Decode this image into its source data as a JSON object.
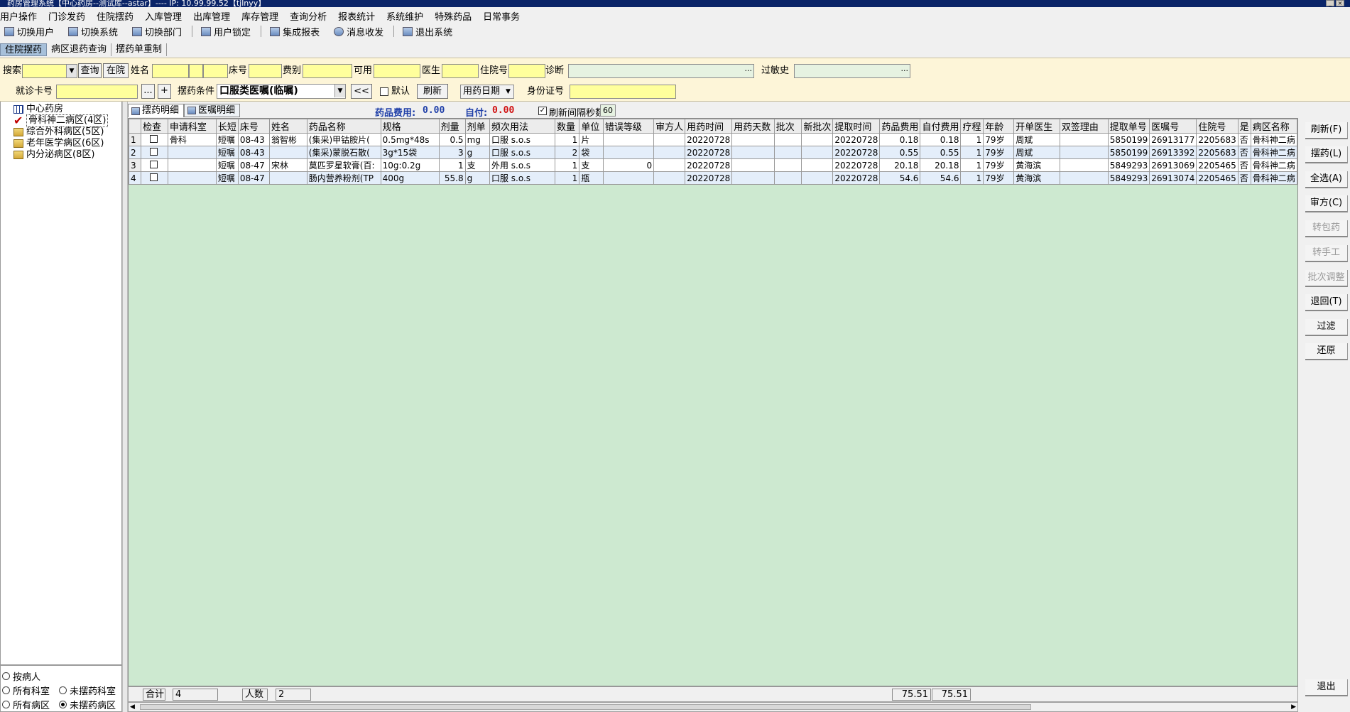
{
  "window": {
    "title": "药房管理系统【中心药房--测试库--astar】---- IP: 10.99.99.52【tjlnyy】",
    "controls": [
      "_",
      "×"
    ]
  },
  "menu": [
    "用户操作",
    "门诊发药",
    "住院摆药",
    "入库管理",
    "出库管理",
    "库存管理",
    "查询分析",
    "报表统计",
    "系统维护",
    "特殊药品",
    "日常事务"
  ],
  "toolbar": [
    {
      "label": "切换用户",
      "icon": "user-switch-icon"
    },
    {
      "label": "切换系统",
      "icon": "system-switch-icon"
    },
    {
      "label": "切换部门",
      "icon": "department-switch-icon"
    },
    {
      "label": "用户锁定",
      "icon": "lock-user-icon"
    },
    {
      "label": "集成报表",
      "icon": "report-icon"
    },
    {
      "label": "消息收发",
      "icon": "message-icon"
    },
    {
      "label": "退出系统",
      "icon": "exit-icon"
    }
  ],
  "tabs": [
    "住院摆药",
    "病区退药查询",
    "摆药单重制"
  ],
  "filters": {
    "search_label": "搜索",
    "search_value": "",
    "query_btn": "查询",
    "inhos_btn": "在院",
    "name_label": "姓名",
    "bed_label": "床号",
    "fee_label": "费别",
    "avail_label": "可用",
    "doctor_label": "医生",
    "inhosno_label": "住院号",
    "diag_label": "诊断",
    "allergy_label": "过敏史",
    "card_label": "就诊卡号",
    "more_btn": "...",
    "plus_btn": "+",
    "cond_label": "摆药条件",
    "cond_value": "口服类医嘱(临嘱)",
    "prev_btn": "<<",
    "default_label": "默认",
    "refresh_btn": "刷新",
    "date_type": "用药日期",
    "id_label": "身份证号"
  },
  "tree": {
    "root": "中心药房",
    "items": [
      "骨科神二病区(4区)",
      "综合外科病区(5区)",
      "老年医学病区(6区)",
      "内分泌病区(8区)"
    ]
  },
  "radios": [
    {
      "label": "按病人",
      "on": false
    },
    {
      "label": "所有科室",
      "on": false
    },
    {
      "label": "未摆药科室",
      "on": false
    },
    {
      "label": "所有病区",
      "on": false
    },
    {
      "label": "未摆药病区",
      "on": true
    }
  ],
  "subtabs": [
    "摆药明细",
    "医嘱明细"
  ],
  "summary": {
    "fee_label": "药品费用:",
    "fee": "0.00",
    "self_label": "自付:",
    "self": "0.00",
    "interval_label": "刷新间隔秒数",
    "interval": "60"
  },
  "grid": {
    "columns": [
      "",
      "检查",
      "申请科室",
      "长短",
      "床号",
      "姓名",
      "药品名称",
      "规格",
      "剂量",
      "剂单",
      "频次用法",
      "数量",
      "单位",
      "错误等级",
      "审方人",
      "用药时间",
      "用药天数",
      "批次",
      "新批次",
      "提取时间",
      "药品费用",
      "自付费用",
      "疗程",
      "年龄",
      "开单医生",
      "双签理由",
      "提取单号",
      "医嘱号",
      "住院号",
      "是",
      "病区名称"
    ],
    "rows": [
      [
        "1",
        "",
        "骨科",
        "短嘱",
        "08-43",
        "翁智彬",
        "(集采)甲钴胺片(",
        "0.5mg*48s",
        "0.5",
        "mg",
        "口服 s.o.s",
        "1",
        "片",
        "",
        "",
        "20220728",
        "",
        "",
        "",
        "20220728",
        "0.18",
        "0.18",
        "1",
        "79岁",
        "周斌",
        "",
        "5850199",
        "26913177",
        "2205683",
        "否",
        "骨科神二病"
      ],
      [
        "2",
        "",
        "",
        "短嘱",
        "08-43",
        "",
        "(集采)蒙脱石散(",
        "3g*15袋",
        "3",
        "g",
        "口服 s.o.s",
        "2",
        "袋",
        "",
        "",
        "20220728",
        "",
        "",
        "",
        "20220728",
        "0.55",
        "0.55",
        "1",
        "79岁",
        "周斌",
        "",
        "5850199",
        "26913392",
        "2205683",
        "否",
        "骨科神二病"
      ],
      [
        "3",
        "",
        "",
        "短嘱",
        "08-47",
        "宋林",
        "莫匹罗星软膏(百:",
        "10g:0.2g",
        "1",
        "支",
        "外用 s.o.s",
        "1",
        "支",
        "0",
        "",
        "20220728",
        "",
        "",
        "",
        "20220728",
        "20.18",
        "20.18",
        "1",
        "79岁",
        "黄海滨",
        "",
        "5849293",
        "26913069",
        "2205465",
        "否",
        "骨科神二病"
      ],
      [
        "4",
        "",
        "",
        "短嘱",
        "08-47",
        "",
        "肠内营养粉剂(TP",
        "400g",
        "55.8",
        "g",
        "口服 s.o.s",
        "1",
        "瓶",
        "",
        "",
        "20220728",
        "",
        "",
        "",
        "20220728",
        "54.6",
        "54.6",
        "1",
        "79岁",
        "黄海滨",
        "",
        "5849293",
        "26913074",
        "2205465",
        "否",
        "骨科神二病"
      ]
    ]
  },
  "footer": {
    "total_label": "合计",
    "total": "4",
    "people_label": "人数",
    "people": "2",
    "fee_sum": "75.51",
    "self_sum": "75.51"
  },
  "right_buttons": [
    {
      "label": "刷新(F)",
      "disabled": false
    },
    {
      "label": "摆药(L)",
      "disabled": false
    },
    {
      "label": "全选(A)",
      "disabled": false
    },
    {
      "label": "审方(C)",
      "disabled": false
    },
    {
      "label": "转包药",
      "disabled": true
    },
    {
      "label": "转手工",
      "disabled": true
    },
    {
      "label": "批次调整",
      "disabled": true
    },
    {
      "label": "退回(T)",
      "disabled": false
    },
    {
      "label": "过滤",
      "disabled": false
    },
    {
      "label": "还原",
      "disabled": false
    }
  ],
  "exit_button": "退出",
  "colors": {
    "title_bar": "#0a2468",
    "filter_bg": "#fdf5d8",
    "input_bg": "#ffff9c",
    "grid_bg": "#cde9d0",
    "alt_row": "#e4eefa",
    "accent_blue": "#1f3fa8",
    "accent_red": "#d01010"
  }
}
